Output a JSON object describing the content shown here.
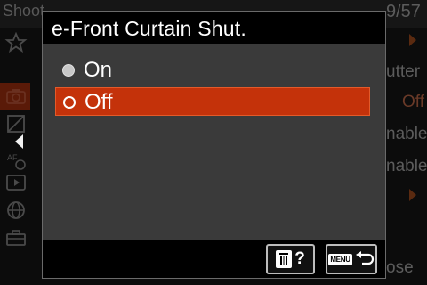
{
  "background": {
    "menu_title": "Shoot",
    "page_number": "9/57",
    "item_texts": [
      "utter",
      "Off",
      "nable",
      "nable",
      "ose"
    ],
    "side_icons": [
      "star-icon",
      "camera-icon",
      "exposure-icon",
      "af-icon",
      "playback-icon",
      "network-icon",
      "toolbox-icon"
    ]
  },
  "dialog": {
    "title": "e-Front Curtain Shut.",
    "options": [
      {
        "label": "On",
        "selected": false
      },
      {
        "label": "Off",
        "selected": true
      }
    ],
    "footer": {
      "help_label": "?",
      "menu_tag": "MENU"
    }
  },
  "colors": {
    "highlight": "#c4320a",
    "dialog_bg": "#3a3a3a",
    "bar_bg": "#000000"
  }
}
